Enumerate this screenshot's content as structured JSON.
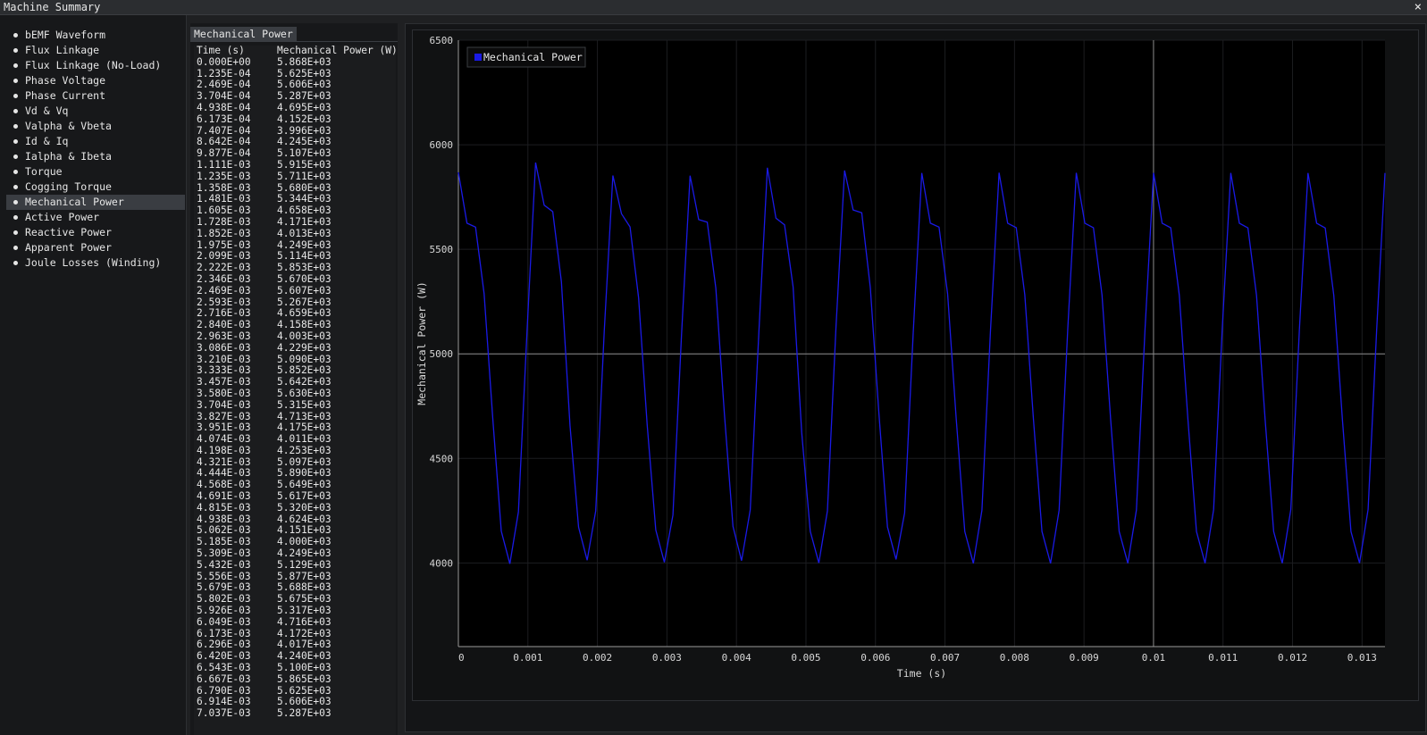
{
  "window": {
    "title": "Machine Summary",
    "close_label": "×"
  },
  "sidebar": {
    "active": "Mechanical Power",
    "items": [
      {
        "label": "bEMF Waveform"
      },
      {
        "label": "Flux Linkage"
      },
      {
        "label": "Flux Linkage (No-Load)"
      },
      {
        "label": "Phase Voltage"
      },
      {
        "label": "Phase Current"
      },
      {
        "label": "Vd & Vq"
      },
      {
        "label": "Valpha & Vbeta"
      },
      {
        "label": "Id & Iq"
      },
      {
        "label": "Ialpha & Ibeta"
      },
      {
        "label": "Torque"
      },
      {
        "label": "Cogging Torque"
      },
      {
        "label": "Mechanical Power"
      },
      {
        "label": "Active Power"
      },
      {
        "label": "Reactive Power"
      },
      {
        "label": "Apparent Power"
      },
      {
        "label": "Joule Losses (Winding)"
      }
    ]
  },
  "table": {
    "tab_label": "Mechanical Power",
    "headers": [
      "Time (s)",
      "Mechanical Power (W)"
    ],
    "rows": [
      [
        "0.000E+00",
        "5.868E+03"
      ],
      [
        "1.235E-04",
        "5.625E+03"
      ],
      [
        "2.469E-04",
        "5.606E+03"
      ],
      [
        "3.704E-04",
        "5.287E+03"
      ],
      [
        "4.938E-04",
        "4.695E+03"
      ],
      [
        "6.173E-04",
        "4.152E+03"
      ],
      [
        "7.407E-04",
        "3.996E+03"
      ],
      [
        "8.642E-04",
        "4.245E+03"
      ],
      [
        "9.877E-04",
        "5.107E+03"
      ],
      [
        "1.111E-03",
        "5.915E+03"
      ],
      [
        "1.235E-03",
        "5.711E+03"
      ],
      [
        "1.358E-03",
        "5.680E+03"
      ],
      [
        "1.481E-03",
        "5.344E+03"
      ],
      [
        "1.605E-03",
        "4.658E+03"
      ],
      [
        "1.728E-03",
        "4.171E+03"
      ],
      [
        "1.852E-03",
        "4.013E+03"
      ],
      [
        "1.975E-03",
        "4.249E+03"
      ],
      [
        "2.099E-03",
        "5.114E+03"
      ],
      [
        "2.222E-03",
        "5.853E+03"
      ],
      [
        "2.346E-03",
        "5.670E+03"
      ],
      [
        "2.469E-03",
        "5.607E+03"
      ],
      [
        "2.593E-03",
        "5.267E+03"
      ],
      [
        "2.716E-03",
        "4.659E+03"
      ],
      [
        "2.840E-03",
        "4.158E+03"
      ],
      [
        "2.963E-03",
        "4.003E+03"
      ],
      [
        "3.086E-03",
        "4.229E+03"
      ],
      [
        "3.210E-03",
        "5.090E+03"
      ],
      [
        "3.333E-03",
        "5.852E+03"
      ],
      [
        "3.457E-03",
        "5.642E+03"
      ],
      [
        "3.580E-03",
        "5.630E+03"
      ],
      [
        "3.704E-03",
        "5.315E+03"
      ],
      [
        "3.827E-03",
        "4.713E+03"
      ],
      [
        "3.951E-03",
        "4.175E+03"
      ],
      [
        "4.074E-03",
        "4.011E+03"
      ],
      [
        "4.198E-03",
        "4.253E+03"
      ],
      [
        "4.321E-03",
        "5.097E+03"
      ],
      [
        "4.444E-03",
        "5.890E+03"
      ],
      [
        "4.568E-03",
        "5.649E+03"
      ],
      [
        "4.691E-03",
        "5.617E+03"
      ],
      [
        "4.815E-03",
        "5.320E+03"
      ],
      [
        "4.938E-03",
        "4.624E+03"
      ],
      [
        "5.062E-03",
        "4.151E+03"
      ],
      [
        "5.185E-03",
        "4.000E+03"
      ],
      [
        "5.309E-03",
        "4.249E+03"
      ],
      [
        "5.432E-03",
        "5.129E+03"
      ],
      [
        "5.556E-03",
        "5.877E+03"
      ],
      [
        "5.679E-03",
        "5.688E+03"
      ],
      [
        "5.802E-03",
        "5.675E+03"
      ],
      [
        "5.926E-03",
        "5.317E+03"
      ],
      [
        "6.049E-03",
        "4.716E+03"
      ],
      [
        "6.173E-03",
        "4.172E+03"
      ],
      [
        "6.296E-03",
        "4.017E+03"
      ],
      [
        "6.420E-03",
        "4.240E+03"
      ],
      [
        "6.543E-03",
        "5.100E+03"
      ],
      [
        "6.667E-03",
        "5.865E+03"
      ],
      [
        "6.790E-03",
        "5.625E+03"
      ],
      [
        "6.914E-03",
        "5.606E+03"
      ],
      [
        "7.037E-03",
        "5.287E+03"
      ]
    ]
  },
  "chart_data": {
    "type": "line",
    "xlabel": "Time (s)",
    "ylabel": "Mechanical Power (W)",
    "xlim": [
      0,
      0.01333
    ],
    "ylim": [
      3600,
      6500
    ],
    "xticks": [
      0,
      0.001,
      0.002,
      0.003,
      0.004,
      0.005,
      0.006,
      0.007,
      0.008,
      0.009,
      0.01,
      0.011,
      0.012,
      0.013
    ],
    "xtick_labels": [
      "0",
      "0.001",
      "0.002",
      "0.003",
      "0.004",
      "0.005",
      "0.006",
      "0.007",
      "0.008",
      "0.009",
      "0.01",
      "0.011",
      "0.012",
      "0.013"
    ],
    "yticks": [
      4000,
      4500,
      5000,
      5500,
      6000,
      6500
    ],
    "ytick_labels": [
      "4000",
      "4500",
      "5000",
      "5500",
      "6000",
      "6500"
    ],
    "legend_placement": "top-left",
    "grid": true,
    "crosshair": {
      "x": 0.01,
      "y": 5000
    },
    "period_s": 0.001111,
    "series": [
      {
        "name": "Mechanical Power",
        "color": "#1a1ae6",
        "x_step": 0.00012346,
        "values": [
          5868,
          5625,
          5606,
          5287,
          4695,
          4152,
          3996,
          4245,
          5107,
          5915,
          5711,
          5680,
          5344,
          4658,
          4171,
          4013,
          4249,
          5114,
          5853,
          5670,
          5607,
          5267,
          4659,
          4158,
          4003,
          4229,
          5090,
          5852,
          5642,
          5630,
          5315,
          4713,
          4175,
          4011,
          4253,
          5097,
          5890,
          5649,
          5617,
          5320,
          4624,
          4151,
          4000,
          4249,
          5129,
          5877,
          5688,
          5675,
          5317,
          4716,
          4172,
          4017,
          4240,
          5100,
          5865,
          5625,
          5606,
          5287
        ]
      }
    ]
  }
}
